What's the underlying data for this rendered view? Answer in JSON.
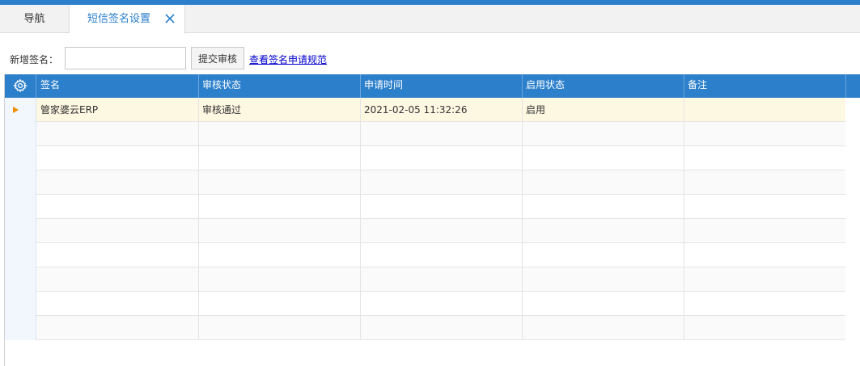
{
  "tabs": {
    "nav_label": "导航",
    "active_label": "短信签名设置"
  },
  "toolbar": {
    "new_sign_label": "新增签名：",
    "sign_input_value": "",
    "sign_input_placeholder": "",
    "submit_label": "提交审核",
    "rule_link_label": "查看签名申请规范"
  },
  "grid": {
    "columns": [
      "签名",
      "审核状态",
      "申请时间",
      "启用状态",
      "备注"
    ],
    "rows": [
      {
        "name": "管家婆云ERP",
        "audit_status": "审核通过",
        "apply_time": "2021-02-05 11:32:26",
        "enable_status": "启用",
        "remark": ""
      }
    ],
    "empty_row_count": 9
  },
  "colors": {
    "accent": "#2b7fcb",
    "selected_row": "#fdf8e2",
    "arrow": "#f08c00",
    "link": "#0000cc"
  },
  "icons": {
    "close": "close-icon",
    "settings": "gear-icon",
    "row_pointer": "row-arrow-icon"
  }
}
